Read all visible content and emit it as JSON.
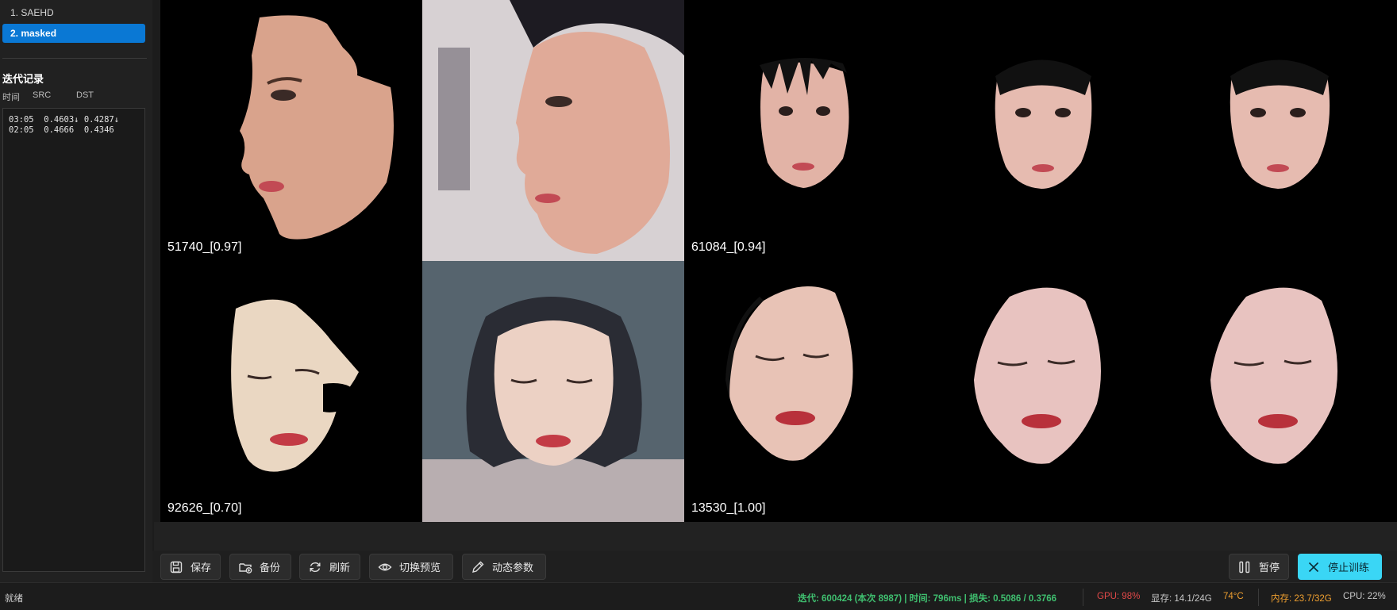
{
  "sidebar": {
    "models": [
      {
        "label": "1. SAEHD",
        "active": false
      },
      {
        "label": "2. masked",
        "active": true
      }
    ],
    "history_title": "迭代记录",
    "columns": {
      "time": "时间",
      "src": "SRC",
      "dst": "DST"
    },
    "history_rows": [
      "03:05  0.4603↓ 0.4287↓",
      "02:05  0.4666  0.4346"
    ]
  },
  "preview": {
    "tiles": [
      {
        "label": "51740_[0.97]"
      },
      {
        "label": ""
      },
      {
        "label": "61084_[0.94]"
      },
      {
        "label": ""
      },
      {
        "label": ""
      },
      {
        "label": "92626_[0.70]"
      },
      {
        "label": ""
      },
      {
        "label": "13530_[1.00]"
      },
      {
        "label": ""
      },
      {
        "label": ""
      }
    ]
  },
  "toolbar": {
    "save": "保存",
    "backup": "备份",
    "refresh": "刷新",
    "toggle_preview": "切换预览",
    "dynamic_params": "动态参数",
    "pause": "暂停",
    "stop": "停止训练"
  },
  "status": {
    "ready": "就绪",
    "iter": "迭代: 600424 (本次 8987) | 时间: 796ms | 损失: 0.5086 / 0.3766",
    "gpu": "GPU: 98%",
    "vram": "显存: 14.1/24G",
    "temp": "74°C",
    "mem": "内存: 23.7/32G",
    "cpu": "CPU: 22%"
  },
  "colors": {
    "accent": "#0a78d4",
    "stop_button": "#3ad6f5",
    "status_green": "#3fbf6f",
    "status_red": "#e04848",
    "status_orange": "#f0a030"
  }
}
